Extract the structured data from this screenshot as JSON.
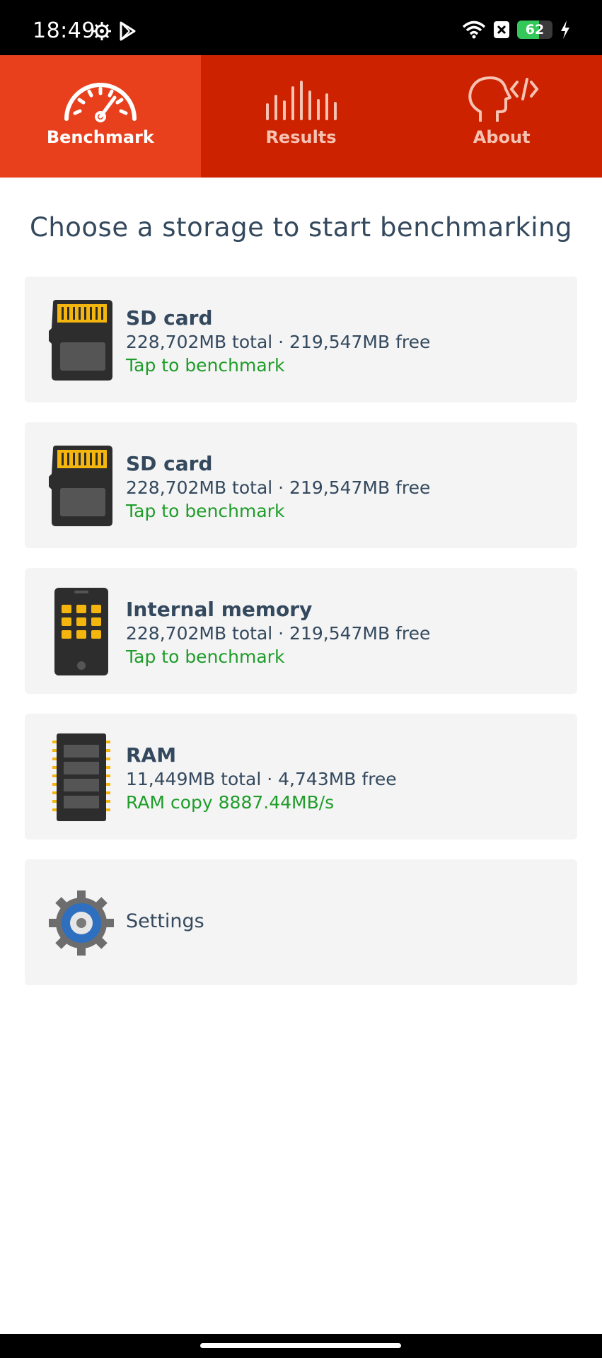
{
  "status": {
    "time": "18:49",
    "battery": "62",
    "battery_level": 0.62,
    "icons": [
      "gear-icon",
      "play-store-icon",
      "wifi-icon",
      "close-box-icon",
      "battery-icon",
      "charging-icon"
    ]
  },
  "tabs": [
    {
      "label": "Benchmark",
      "icon": "speedometer-icon",
      "active": true
    },
    {
      "label": "Results",
      "icon": "bars-icon",
      "active": false
    },
    {
      "label": "About",
      "icon": "head-code-icon",
      "active": false
    }
  ],
  "title": "Choose a storage to start benchmarking",
  "storages": [
    {
      "name": "SD card",
      "sizes": "228,702MB total · 219,547MB free",
      "action": "Tap to benchmark",
      "icon": "sd-card-icon"
    },
    {
      "name": "SD card",
      "sizes": "228,702MB total · 219,547MB free",
      "action": "Tap to benchmark",
      "icon": "sd-card-icon"
    },
    {
      "name": "Internal memory",
      "sizes": "228,702MB total · 219,547MB free",
      "action": "Tap to benchmark",
      "icon": "phone-icon"
    },
    {
      "name": "RAM",
      "sizes": "11,449MB total · 4,743MB free",
      "action": "RAM copy 8887.44MB/s",
      "icon": "ram-icon"
    }
  ],
  "settings": {
    "label": "Settings",
    "icon": "settings-gear-icon"
  },
  "colors": {
    "accent": "#cc2200",
    "active_tab": "#e8401c",
    "green": "#1f9d2a",
    "text": "#34495e"
  }
}
